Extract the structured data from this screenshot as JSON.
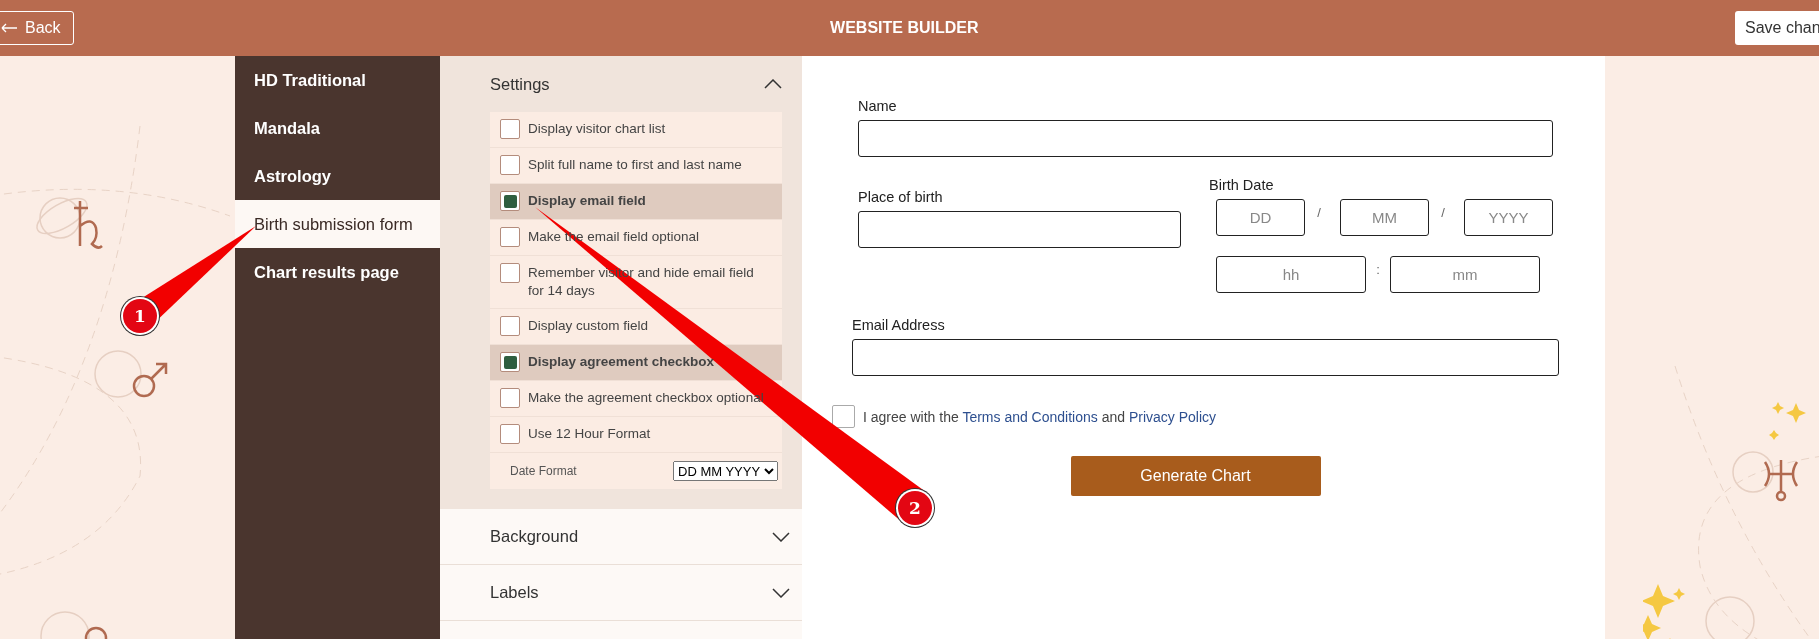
{
  "header": {
    "back_button": "Back",
    "title": "WEBSITE BUILDER",
    "save_button": "Save chan"
  },
  "sidebar": {
    "items": [
      {
        "label": "HD Traditional",
        "selected": false
      },
      {
        "label": "Mandala",
        "selected": false
      },
      {
        "label": "Astrology",
        "selected": false
      },
      {
        "label": "Birth submission form",
        "selected": true
      },
      {
        "label": "Chart results page",
        "selected": false
      }
    ]
  },
  "settings": {
    "title": "Settings",
    "expanded": true,
    "options": [
      {
        "label": "Display visitor chart list",
        "checked": false
      },
      {
        "label": "Split full name to first and last name",
        "checked": false
      },
      {
        "label": "Display email field",
        "checked": true
      },
      {
        "label": "Make the email field optional",
        "checked": false
      },
      {
        "label": "Remember visitor and hide email field for 14 days",
        "checked": false
      },
      {
        "label": "Display custom field",
        "checked": false
      },
      {
        "label": "Display agreement checkbox",
        "checked": true
      },
      {
        "label": "Make the agreement checkbox optional",
        "checked": false
      },
      {
        "label": "Use 12 Hour Format",
        "checked": false
      }
    ],
    "date_format": {
      "label": "Date Format",
      "value": "DD MM YYYY"
    }
  },
  "sections": [
    {
      "title": "Background",
      "expanded": false
    },
    {
      "title": "Labels",
      "expanded": false
    }
  ],
  "form": {
    "name_label": "Name",
    "place_label": "Place of birth",
    "birth_date_label": "Birth Date",
    "date_fields": [
      {
        "placeholder": "DD"
      },
      {
        "placeholder": "MM"
      },
      {
        "placeholder": "YYYY"
      }
    ],
    "date_separators": [
      "/",
      "/"
    ],
    "time_fields": [
      {
        "placeholder": "hh"
      },
      {
        "placeholder": "mm"
      }
    ],
    "time_separator": ":",
    "email_label": "Email Address",
    "agreement": {
      "checked": false,
      "parts": [
        {
          "kind": "text",
          "text": "I agree with the "
        },
        {
          "kind": "link",
          "text": "Terms and Conditions"
        },
        {
          "kind": "text",
          "text": " and "
        },
        {
          "kind": "link",
          "text": "Privacy Policy"
        }
      ]
    },
    "submit_button": "Generate Chart"
  },
  "annotations": [
    {
      "number": "1"
    },
    {
      "number": "2"
    }
  ]
}
